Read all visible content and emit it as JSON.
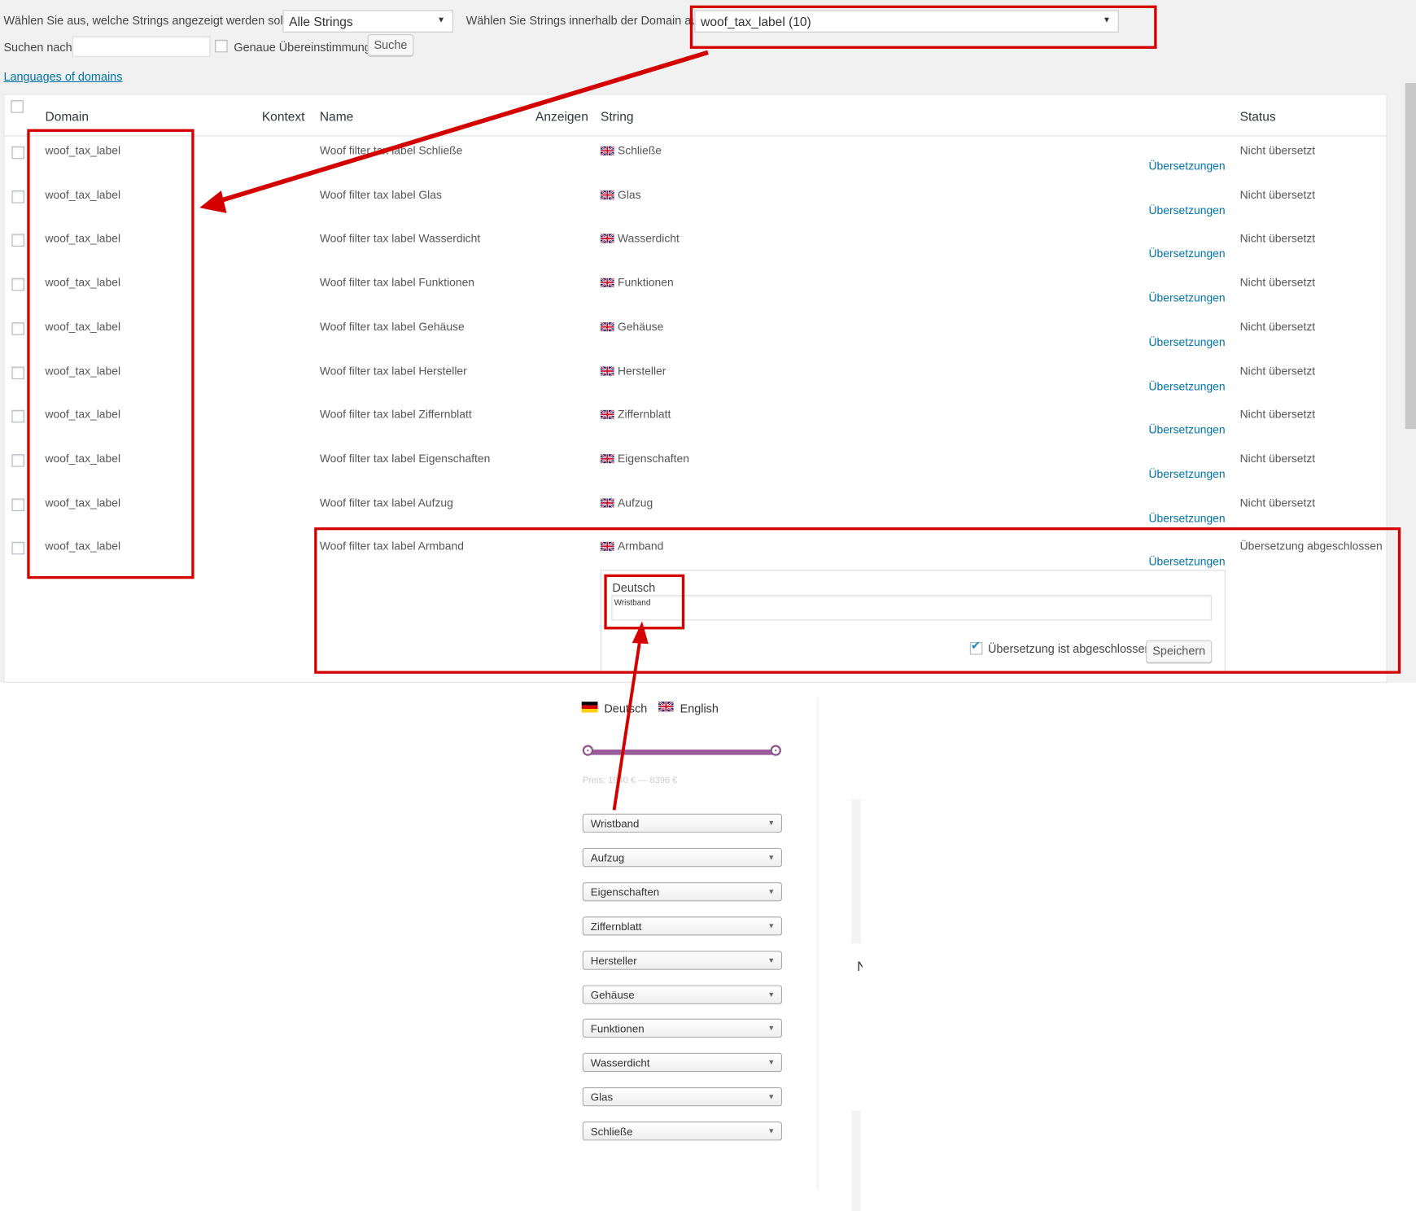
{
  "filters": {
    "show_label": "Wählen Sie aus, welche Strings angezeigt werden sollen:",
    "show_value": "Alle Strings",
    "domain_label": "Wählen Sie Strings innerhalb der Domain aus:",
    "domain_value": "woof_tax_label (10)",
    "search_label": "Suchen nach:",
    "search_value": "",
    "exact_label": "Genaue Übereinstimmung",
    "search_button": "Suche",
    "languages_link": "Languages of domains"
  },
  "table": {
    "headers": {
      "domain": "Domain",
      "context": "Kontext",
      "name": "Name",
      "view": "Anzeigen",
      "string": "String",
      "status": "Status"
    },
    "translations_link": "Übersetzungen",
    "rows": [
      {
        "domain": "woof_tax_label",
        "name": "Woof filter tax label Schließe",
        "string": "Schließe",
        "status": "Nicht übersetzt"
      },
      {
        "domain": "woof_tax_label",
        "name": "Woof filter tax label Glas",
        "string": "Glas",
        "status": "Nicht übersetzt"
      },
      {
        "domain": "woof_tax_label",
        "name": "Woof filter tax label Wasserdicht",
        "string": "Wasserdicht",
        "status": "Nicht übersetzt"
      },
      {
        "domain": "woof_tax_label",
        "name": "Woof filter tax label Funktionen",
        "string": "Funktionen",
        "status": "Nicht übersetzt"
      },
      {
        "domain": "woof_tax_label",
        "name": "Woof filter tax label Gehäuse",
        "string": "Gehäuse",
        "status": "Nicht übersetzt"
      },
      {
        "domain": "woof_tax_label",
        "name": "Woof filter tax label Hersteller",
        "string": "Hersteller",
        "status": "Nicht übersetzt"
      },
      {
        "domain": "woof_tax_label",
        "name": "Woof filter tax label Ziffernblatt",
        "string": "Ziffernblatt",
        "status": "Nicht übersetzt"
      },
      {
        "domain": "woof_tax_label",
        "name": "Woof filter tax label Eigenschaften",
        "string": "Eigenschaften",
        "status": "Nicht übersetzt"
      },
      {
        "domain": "woof_tax_label",
        "name": "Woof filter tax label Aufzug",
        "string": "Aufzug",
        "status": "Nicht übersetzt"
      },
      {
        "domain": "woof_tax_label",
        "name": "Woof filter tax label Armband",
        "string": "Armband",
        "status": "Übersetzung abgeschlossen"
      }
    ]
  },
  "editor": {
    "language": "Deutsch",
    "translation": "Wristband",
    "complete_label": "Übersetzung ist abgeschlossen",
    "save_button": "Speichern"
  },
  "frontend": {
    "lang_de": "Deutsch",
    "lang_en": "English",
    "price_text": "Preis: 1940 € — 8396 €",
    "slider_color": "#9b5c9b",
    "dropdowns": [
      "Wristband",
      "Aufzug",
      "Eigenschaften",
      "Ziffernblatt",
      "Hersteller",
      "Gehäuse",
      "Funktionen",
      "Wasserdicht",
      "Glas",
      "Schließe"
    ]
  },
  "colors": {
    "annotation": "#d40000",
    "link": "#0073aa"
  }
}
